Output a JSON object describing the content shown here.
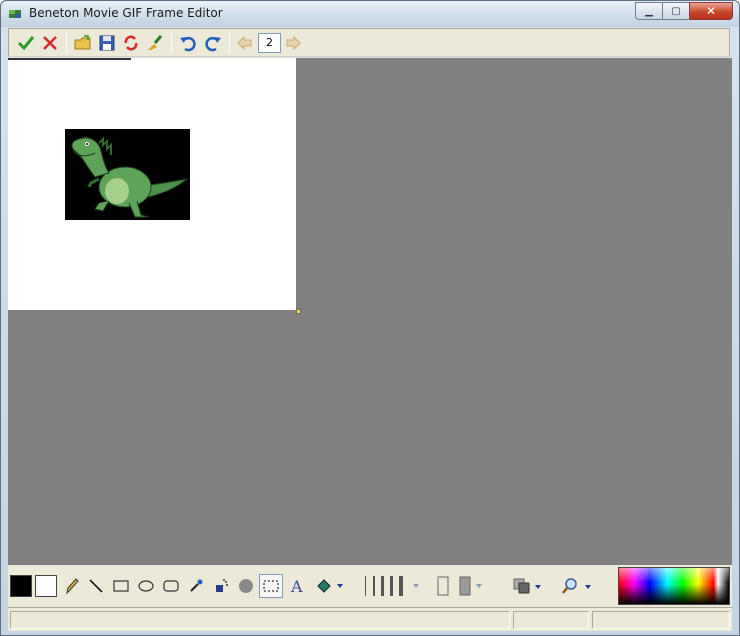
{
  "window": {
    "title": "Beneton Movie GIF Frame Editor",
    "minimize_symbol": "▁",
    "maximize_symbol": "▢",
    "close_symbol": "✕"
  },
  "toolbar": {
    "frame_number": "2"
  },
  "status": {
    "panel1": "",
    "panel2": "",
    "panel3": ""
  },
  "colors": {
    "foreground": "#000000",
    "background": "#ffffff",
    "canvas_bg": "#808080",
    "accent_green": "#2a9d2a",
    "accent_red": "#d42a2a",
    "accent_blue": "#1f5fbf"
  },
  "icons": [
    "check-icon",
    "cancel-icon",
    "open-folder-icon",
    "save-icon",
    "refresh-icon",
    "clear-brush-icon",
    "undo-icon",
    "redo-icon",
    "prev-arrow-icon",
    "next-arrow-icon",
    "pencil-icon",
    "line-icon",
    "rectangle-icon",
    "ellipse-icon",
    "rounded-rect-icon",
    "eyedropper-icon",
    "spray-icon",
    "circle-brush-icon",
    "selection-icon",
    "text-icon",
    "fill-bucket-icon",
    "line-width-icon",
    "fill-style-icon",
    "layers-icon",
    "zoom-icon"
  ]
}
